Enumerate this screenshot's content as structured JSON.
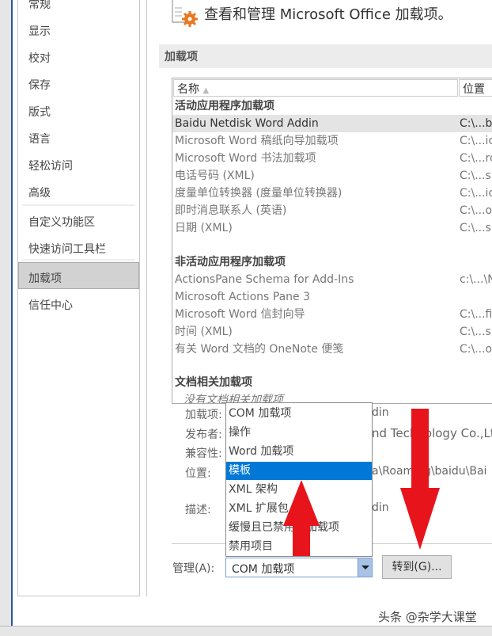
{
  "sidebar": {
    "items": [
      "常规",
      "显示",
      "校对",
      "保存",
      "版式",
      "语言",
      "轻松访问",
      "高级",
      "自定义功能区",
      "快速访问工具栏",
      "加载项",
      "信任中心"
    ],
    "selected": "加载项"
  },
  "header": {
    "title": "查看和管理 Microsoft Office 加载项。"
  },
  "section": {
    "title": "加载项"
  },
  "list": {
    "columns": [
      "名称",
      "位置"
    ],
    "groups": [
      {
        "title": "活动应用程序加载项",
        "rows": [
          {
            "name": "Baidu Netdisk Word Addin",
            "path": "C:\\...b"
          },
          {
            "name": "Microsoft Word 稿纸向导加载项",
            "path": "C:\\...ic"
          },
          {
            "name": "Microsoft Word 书法加载项",
            "path": "C:\\...rc"
          },
          {
            "name": "电话号码 (XML)",
            "path": "C:\\...s'"
          },
          {
            "name": "度量单位转换器 (度量单位转换器)",
            "path": "C:\\...ic"
          },
          {
            "name": "即时消息联系人 (英语)",
            "path": "C:\\...o"
          },
          {
            "name": "日期 (XML)",
            "path": "C:\\...s'"
          }
        ]
      },
      {
        "title": "非活动应用程序加载项",
        "rows": [
          {
            "name": "ActionsPane Schema for Add-Ins",
            "path": "c:\\...\\N"
          },
          {
            "name": "Microsoft Actions Pane 3",
            "path": ""
          },
          {
            "name": "Microsoft Word 信封向导",
            "path": "C:\\...fi"
          },
          {
            "name": "时间 (XML)",
            "path": "C:\\...s'"
          },
          {
            "name": "有关 Word 文档的 OneNote 便笺",
            "path": "C:\\...o"
          }
        ]
      },
      {
        "title": "文档相关加载项",
        "rows": [
          {
            "name": "没有文档相关加载项",
            "path": ""
          }
        ]
      }
    ]
  },
  "details": {
    "labels": [
      "加载项:",
      "发布者:",
      "兼容性:",
      "位置:",
      "描述:"
    ],
    "values": [
      "din",
      "nd Technology Co.,Lt",
      "",
      "a\\Roaming\\baidu\\Bai",
      "din"
    ]
  },
  "dropdown": {
    "options": [
      "COM 加载项",
      "操作",
      "Word 加载项",
      "模板",
      "XML 架构",
      "XML 扩展包",
      "缓慢且已禁用的加载项",
      "禁用项目"
    ],
    "highlighted": "模板"
  },
  "manage": {
    "label": "管理(A):",
    "value": "COM 加载项",
    "go_label": "转到(G)..."
  },
  "watermark": "头条 @杂学大课堂",
  "colors": {
    "highlight": "#0078d7",
    "arrow": "#e8141c",
    "icon_gear": "#e87722"
  }
}
